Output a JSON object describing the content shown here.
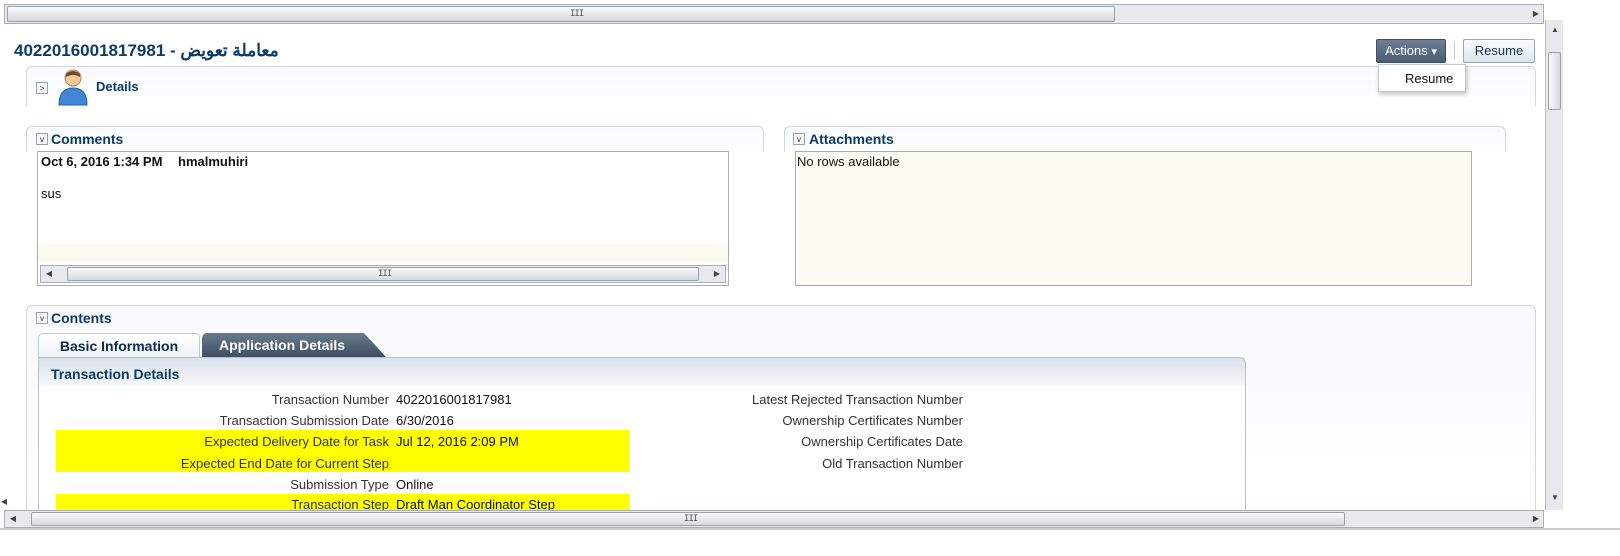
{
  "page": {
    "title": "4022016001817981 - معاملة تعويض"
  },
  "scroll": {
    "grip": "III"
  },
  "actions": {
    "label": "Actions",
    "caret": "▾",
    "menu_items": [
      "Resume"
    ],
    "resume_label": "Resume"
  },
  "details": {
    "toggle": ">",
    "label": "Details"
  },
  "comments": {
    "toggle": "v",
    "title": "Comments",
    "items": [
      {
        "date": "Oct 6, 2016 1:34 PM",
        "user": "hmalmuhiri",
        "text": "sus"
      }
    ]
  },
  "attachments": {
    "toggle": "v",
    "title": "Attachments",
    "empty_text": "No rows available"
  },
  "contents": {
    "toggle": "v",
    "title": "Contents",
    "tabs": [
      {
        "label": "Basic Information",
        "active": true
      },
      {
        "label": "Application Details",
        "active": false
      }
    ],
    "section_title": "Transaction Details",
    "left_fields": [
      {
        "label": "Transaction Number",
        "value": "4022016001817981",
        "highlight": false
      },
      {
        "label": "Transaction Submission Date",
        "value": "6/30/2016",
        "highlight": false
      },
      {
        "label": "Expected Delivery Date for Task",
        "value": "Jul 12, 2016 2:09 PM",
        "highlight": true
      },
      {
        "label": "Expected End Date for Current Step",
        "value": "",
        "highlight": true
      },
      {
        "label": "Submission Type",
        "value": "Online",
        "highlight": false
      },
      {
        "label": "Transaction Step",
        "value": "Draft Man Coordinator Step",
        "highlight": true
      }
    ],
    "right_fields": [
      {
        "label": "Latest Rejected Transaction Number",
        "value": ""
      },
      {
        "label": "Ownership Certificates Number",
        "value": ""
      },
      {
        "label": "Ownership Certificates Date",
        "value": ""
      },
      {
        "label": "Old Transaction Number",
        "value": ""
      }
    ]
  },
  "colors": {
    "highlight": "#ffff00",
    "title": "#0b3b66"
  }
}
